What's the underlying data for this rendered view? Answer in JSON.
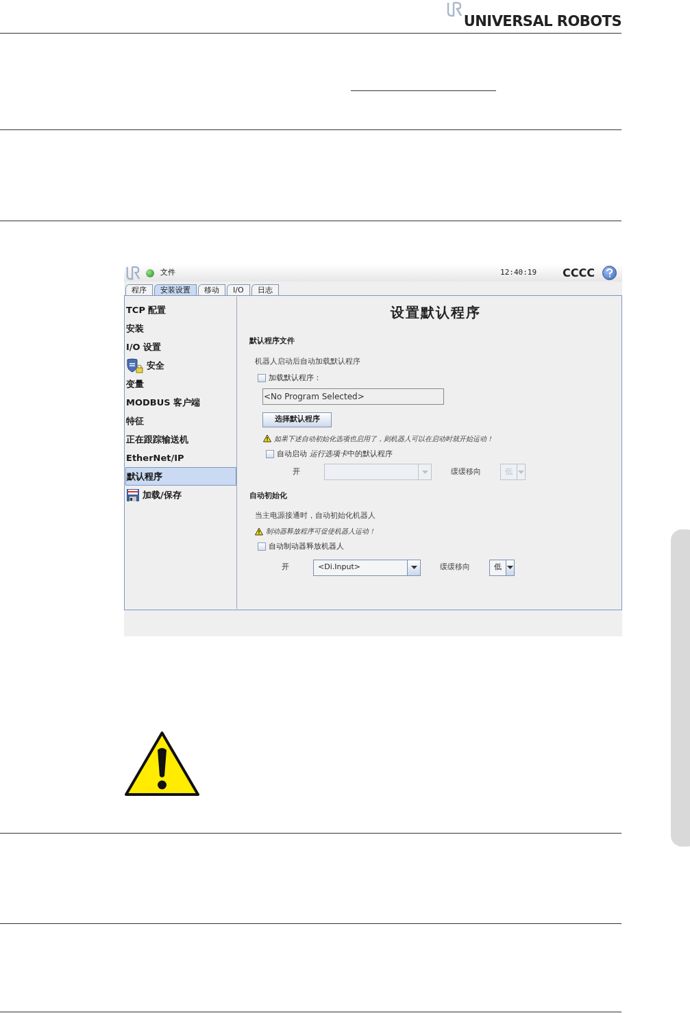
{
  "header": {
    "brand": "UNIVERSAL ROBOTS"
  },
  "app": {
    "menu": "文件",
    "status_on": true,
    "time": "12:40:19",
    "robot_name": "CCCC",
    "tabs": [
      {
        "label": "程序",
        "selected": false
      },
      {
        "label": "安装设置",
        "selected": true
      },
      {
        "label": "移动",
        "selected": false
      },
      {
        "label": "I/O",
        "selected": false
      },
      {
        "label": "日志",
        "selected": false
      }
    ],
    "sidebar": {
      "items": [
        {
          "label": "TCP 配置",
          "kind": "plain",
          "selected": false
        },
        {
          "label": "安装",
          "kind": "plain",
          "selected": false
        },
        {
          "label": "I/O 设置",
          "kind": "plain",
          "selected": false
        },
        {
          "label": "安全",
          "kind": "safety",
          "selected": false
        },
        {
          "label": "变量",
          "kind": "plain",
          "selected": false
        },
        {
          "label": "MODBUS 客户端",
          "kind": "plain",
          "selected": false
        },
        {
          "label": "特征",
          "kind": "plain",
          "selected": false
        },
        {
          "label": "正在跟踪输送机",
          "kind": "plain",
          "selected": false
        },
        {
          "label": "EtherNet/IP",
          "kind": "plain",
          "selected": false
        },
        {
          "label": "默认程序",
          "kind": "plain",
          "selected": true
        },
        {
          "label": "加载/保存",
          "kind": "disk",
          "selected": false
        }
      ]
    },
    "panel": {
      "title": "设置默认程序",
      "sections": [
        {
          "heading": "默认程序文件",
          "description": "机器人启动后自动加载默认程序",
          "checkbox": {
            "label": "加载默认程序：",
            "checked": false
          },
          "program_field": {
            "value": "<No Program Selected>"
          },
          "select_button": "选择默认程序",
          "warning": "如果下述自动初始化选项也启用了，则机器人可以在启动时就开始运动！",
          "auto_checkbox": {
            "label": "自动启动 ",
            "label_italic": "运行选项卡",
            "label_end": "中的默认程序",
            "checked": false
          },
          "input_row": {
            "label": "开",
            "dropdown": {
              "disabled": true
            },
            "edge_label": "缓缓移向",
            "edge_dropdown": {
              "value": "低",
              "disabled": true
            }
          }
        },
        {
          "heading": "自动初始化",
          "description": "当主电源接通时，自动初始化机器人",
          "warning": "制动器释放程序可促使机器人运动！",
          "auto_checkbox": {
            "label": "自动制动器释放机器人",
            "checked": false
          },
          "input_row": {
            "label": "开",
            "dropdown": {
              "value": "<Di.Input>",
              "disabled": false
            },
            "edge_label": "缓缓移向",
            "edge_dropdown": {
              "value": "低",
              "disabled": false
            }
          }
        }
      ]
    }
  }
}
